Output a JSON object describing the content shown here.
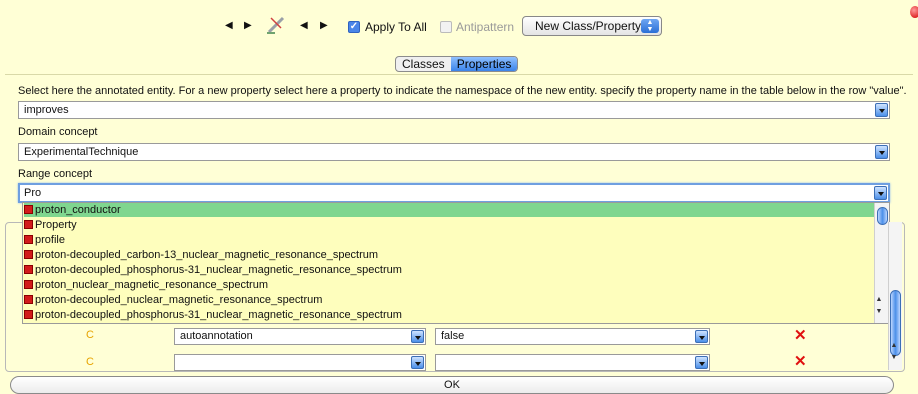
{
  "toolbar": {
    "apply_to_all": {
      "label": "Apply To All",
      "checked": true
    },
    "antipattern": {
      "label": "Antipattern",
      "checked": false
    },
    "select_value": "New Class/Property"
  },
  "segmented": {
    "classes": "Classes",
    "properties": "Properties",
    "active": "Properties"
  },
  "instruction": "Select here the annotated entity. For a new property select here a property to indicate the namespace of the new entity. specify the property name in the table below in the row \"value\".",
  "entity_value": "improves",
  "domain": {
    "label": "Domain concept",
    "value": "ExperimentalTechnique"
  },
  "range": {
    "label": "Range concept",
    "value": "Pro"
  },
  "suggestions": [
    "proton_conductor",
    "Property",
    "profile",
    "proton-decoupled_carbon-13_nuclear_magnetic_resonance_spectrum",
    "proton-decoupled_phosphorus-31_nuclear_magnetic_resonance_spectrum",
    "proton_nuclear_magnetic_resonance_spectrum",
    "proton-decoupled_nuclear_magnetic_resonance_spectrum",
    "proton-decoupled_phosphorus-31_nuclear_magnetic_resonance_spectrum"
  ],
  "table_rows": [
    {
      "marker": "C",
      "property": "autoannotation",
      "value": "false"
    },
    {
      "marker": "C",
      "property": "",
      "value": ""
    }
  ],
  "ok_label": "OK",
  "colors": {
    "background": "#ffffd6",
    "selection": "#7fd68f",
    "accent": "#4b8fe9",
    "delete": "#e01010"
  }
}
